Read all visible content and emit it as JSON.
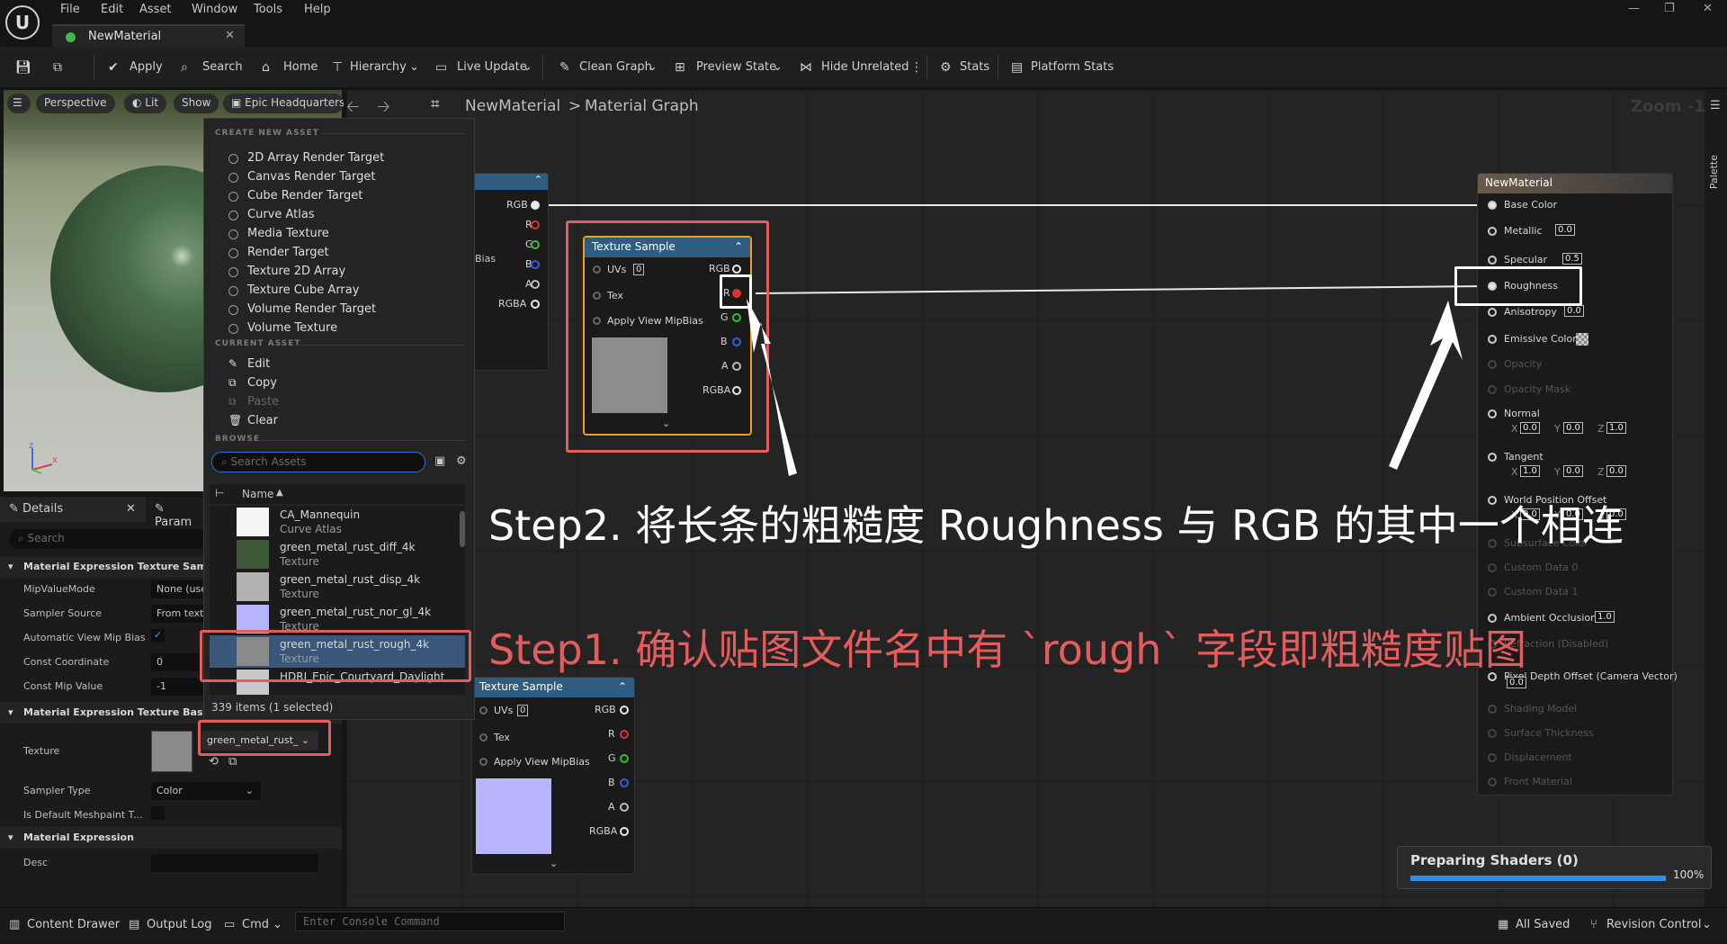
{
  "app": {
    "menus": [
      "File",
      "Edit",
      "Asset",
      "Window",
      "Tools",
      "Help"
    ],
    "tab_title": "NewMaterial"
  },
  "toolbar": {
    "apply": "Apply",
    "search": "Search",
    "home": "Home",
    "hierarchy": "Hierarchy",
    "live_update": "Live Update",
    "clean_graph": "Clean Graph",
    "preview_state": "Preview State",
    "hide_unrelated": "Hide Unrelated",
    "stats": "Stats",
    "platform_stats": "Platform Stats"
  },
  "viewport": {
    "perspective": "Perspective",
    "lit": "Lit",
    "show": "Show",
    "level": "Epic Headquarters"
  },
  "breadcrumb": {
    "root": "NewMaterial",
    "sep": ">",
    "current": "Material Graph",
    "zoom": "Zoom -1",
    "palette": "Palette"
  },
  "popup": {
    "create_header": "CREATE NEW ASSET",
    "create_items": [
      "2D Array Render Target",
      "Canvas Render Target",
      "Cube Render Target",
      "Curve Atlas",
      "Media Texture",
      "Render Target",
      "Texture 2D Array",
      "Texture Cube Array",
      "Volume Render Target",
      "Volume Texture"
    ],
    "current_header": "CURRENT ASSET",
    "current_items": [
      "Edit",
      "Copy",
      "Paste",
      "Clear"
    ],
    "browse_header": "BROWSE",
    "search_placeholder": "Search Assets",
    "column_name": "Name",
    "assets": [
      {
        "name": "CA_Mannequin",
        "type": "Curve Atlas"
      },
      {
        "name": "green_metal_rust_diff_4k",
        "type": "Texture"
      },
      {
        "name": "green_metal_rust_disp_4k",
        "type": "Texture"
      },
      {
        "name": "green_metal_rust_nor_gl_4k",
        "type": "Texture"
      },
      {
        "name": "green_metal_rust_rough_4k",
        "type": "Texture"
      },
      {
        "name": "HDRI_Epic_Courtyard_Daylight",
        "type": ""
      }
    ],
    "footer": "339 items (1 selected)"
  },
  "details": {
    "tab_details": "Details",
    "tab_params": "Param",
    "search_placeholder": "Search",
    "section1": "Material Expression Texture Sample",
    "rows1": [
      {
        "label": "MipValueMode",
        "value": "None (use"
      },
      {
        "label": "Sampler Source",
        "value": "From textu"
      },
      {
        "label": "Automatic View Mip Bias",
        "value": ""
      },
      {
        "label": "Const Coordinate",
        "value": "0"
      },
      {
        "label": "Const Mip Value",
        "value": "-1"
      }
    ],
    "section2": "Material Expression Texture Base",
    "texture_label": "Texture",
    "texture_value": "green_metal_rust_",
    "sampler_type_label": "Sampler Type",
    "sampler_type_value": "Color",
    "default_meshpaint": "Is Default Meshpaint T...",
    "section3": "Material Expression",
    "desc_label": "Desc"
  },
  "nodes": {
    "partial_pins": [
      "RGB",
      "R",
      "G",
      "B",
      "A",
      "RGBA"
    ],
    "partial_bias": "Bias",
    "texture_sample_title": "Texture Sample",
    "ts_inputs": [
      "UVs",
      "Tex",
      "Apply View MipBias"
    ],
    "ts_uvs_value": "0",
    "ts_outputs": [
      "RGB",
      "R",
      "G",
      "B",
      "A",
      "RGBA"
    ],
    "material_title": "NewMaterial",
    "material_pins": [
      {
        "label": "Base Color",
        "value": ""
      },
      {
        "label": "Metallic",
        "value": "0.0"
      },
      {
        "label": "Specular",
        "value": "0.5"
      },
      {
        "label": "Roughness",
        "value": ""
      },
      {
        "label": "Anisotropy",
        "value": "0.0"
      },
      {
        "label": "Emissive Color",
        "value": ""
      }
    ],
    "material_dim": [
      "Opacity",
      "Opacity Mask"
    ],
    "normal": {
      "label": "Normal",
      "x": "0.0",
      "y": "0.0",
      "z": "1.0"
    },
    "tangent": {
      "label": "Tangent",
      "x": "1.0",
      "y": "0.0",
      "z": "0.0"
    },
    "world_pos": {
      "label": "World Position Offset",
      "x": "0.0",
      "y": "0.0",
      "z": "0.0"
    },
    "material_dim2": [
      "Subsurface Color",
      "Custom Data 0",
      "Custom Data 1"
    ],
    "ambient": {
      "label": "Ambient Occlusion",
      "value": "1.0"
    },
    "refraction": "Refraction (Disabled)",
    "pixel_depth": {
      "label": "Pixel Depth Offset (Camera Vector)",
      "value": "0.0"
    },
    "material_dim3": [
      "Shading Model",
      "Surface Thickness",
      "Displacement",
      "Front Material"
    ]
  },
  "annotations": {
    "step2": "Step2. 将长条的粗糙度 Roughness 与 RGB 的其中一个相连",
    "step1": "Step1. 确认贴图文件名中有 `rough` 字段即粗糙度贴图"
  },
  "shader": {
    "label": "Preparing Shaders (0)",
    "percent": "100%",
    "progress": 1.0
  },
  "statusbar": {
    "content_drawer": "Content Drawer",
    "output_log": "Output Log",
    "cmd": "Cmd",
    "console_placeholder": "Enter Console Command",
    "all_saved": "All Saved",
    "revision_control": "Revision Control"
  },
  "colors": {
    "accent_red": "#e35d5d",
    "node_header": "#2f5d82",
    "selected_node": "#f0a020"
  }
}
